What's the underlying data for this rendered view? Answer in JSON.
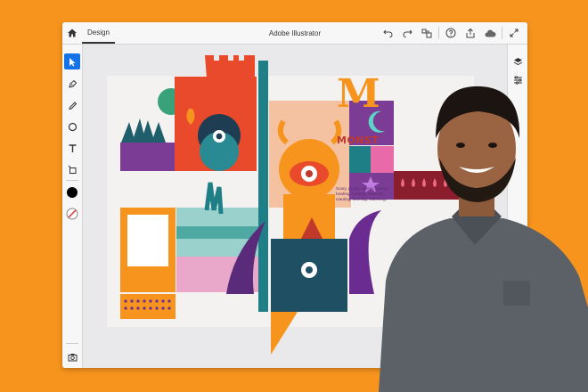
{
  "app": {
    "title": "Adobe Illustrator",
    "active_tab": "Design"
  },
  "toolbar_top": {
    "icons": [
      "home-icon",
      "undo-icon",
      "redo-icon",
      "transform-icon",
      "help-icon",
      "share-icon",
      "cloud-icon",
      "fullscreen-icon"
    ]
  },
  "tools_left": [
    "select-tool",
    "pen-tool",
    "pencil-tool",
    "ellipse-tool",
    "type-tool",
    "place-image-tool",
    "fill-color",
    "stroke-none",
    "camera-tool",
    "image-import-tool"
  ],
  "panels_right": [
    "layers-icon",
    "properties-icon"
  ],
  "colors": {
    "background": "#f7941d",
    "accent": "#1473e6",
    "purple": "#6b2c91",
    "teal": "#1f5f6b",
    "red": "#e84a2b",
    "green": "#3aa27a"
  },
  "artwork": {
    "brand_letter": "M",
    "brand_word": "MONST",
    "blurb": "Scary, gooey, creepy, crawly, howling, hooting, clanking, mauling, looming, slithering,"
  }
}
